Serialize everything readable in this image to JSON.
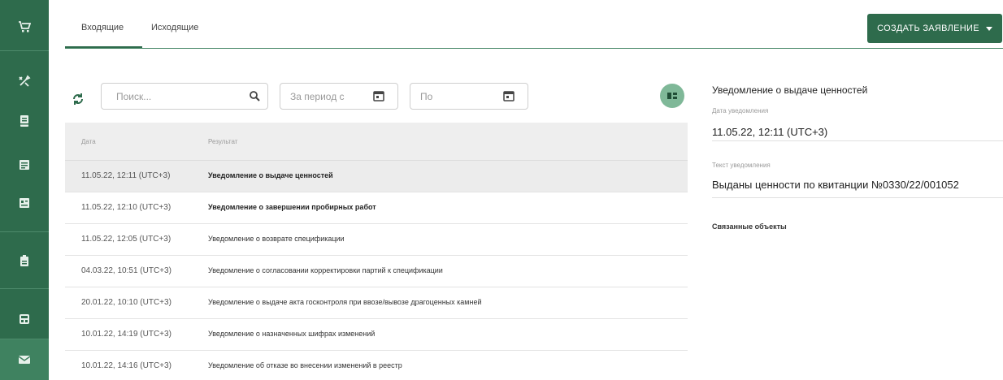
{
  "sidebar": {
    "items": [
      {
        "icon": "cart-icon"
      },
      {
        "icon": "tools-icon"
      },
      {
        "icon": "inbox-icon"
      },
      {
        "icon": "document-icon"
      },
      {
        "icon": "table-icon"
      },
      {
        "icon": "briefcase-icon"
      },
      {
        "icon": "calculator-icon"
      },
      {
        "icon": "mail-icon",
        "active": true
      }
    ]
  },
  "tabs": [
    {
      "label": "Входящие",
      "active": true
    },
    {
      "label": "Исходящие",
      "active": false
    }
  ],
  "create_button": {
    "label": "СОЗДАТЬ ЗАЯВЛЕНИЕ"
  },
  "toolbar": {
    "search_placeholder": "Поиск...",
    "period_from_placeholder": "За период с",
    "period_to_placeholder": "По"
  },
  "table": {
    "columns": [
      "Дата",
      "Результат"
    ],
    "rows": [
      {
        "date": "11.05.22, 12:11 (UTC+3)",
        "result": "Уведомление о выдаче ценностей",
        "selected": true,
        "bold": true
      },
      {
        "date": "11.05.22, 12:10 (UTC+3)",
        "result": "Уведомление о завершении пробирных работ",
        "selected": false,
        "bold": true
      },
      {
        "date": "11.05.22, 12:05 (UTC+3)",
        "result": "Уведомление о возврате спецификации",
        "selected": false,
        "bold": false
      },
      {
        "date": "04.03.22, 10:51 (UTC+3)",
        "result": "Уведомление о согласовании корректировки партий к спецификации",
        "selected": false,
        "bold": false
      },
      {
        "date": "20.01.22, 10:10 (UTC+3)",
        "result": "Уведомление о выдаче акта госконтроля при ввозе/вывозе драгоценных камней",
        "selected": false,
        "bold": false
      },
      {
        "date": "10.01.22, 14:19 (UTC+3)",
        "result": "Уведомление о назначенных шифрах изменений",
        "selected": false,
        "bold": false
      },
      {
        "date": "10.01.22, 14:16 (UTC+3)",
        "result": "Уведомление об отказе во внесении изменений в реестр",
        "selected": false,
        "bold": false
      }
    ]
  },
  "detail": {
    "title": "Уведомление о выдаче ценностей",
    "date_label": "Дата уведомления",
    "date_value": "11.05.22, 12:11 (UTC+3)",
    "text_label": "Текст уведомления",
    "text_value": "Выданы ценности по квитанции №0330/22/001052",
    "related_label": "Связанные объекты"
  },
  "colors": {
    "primary": "#2e6b4c",
    "primary_light": "#7fb898"
  }
}
